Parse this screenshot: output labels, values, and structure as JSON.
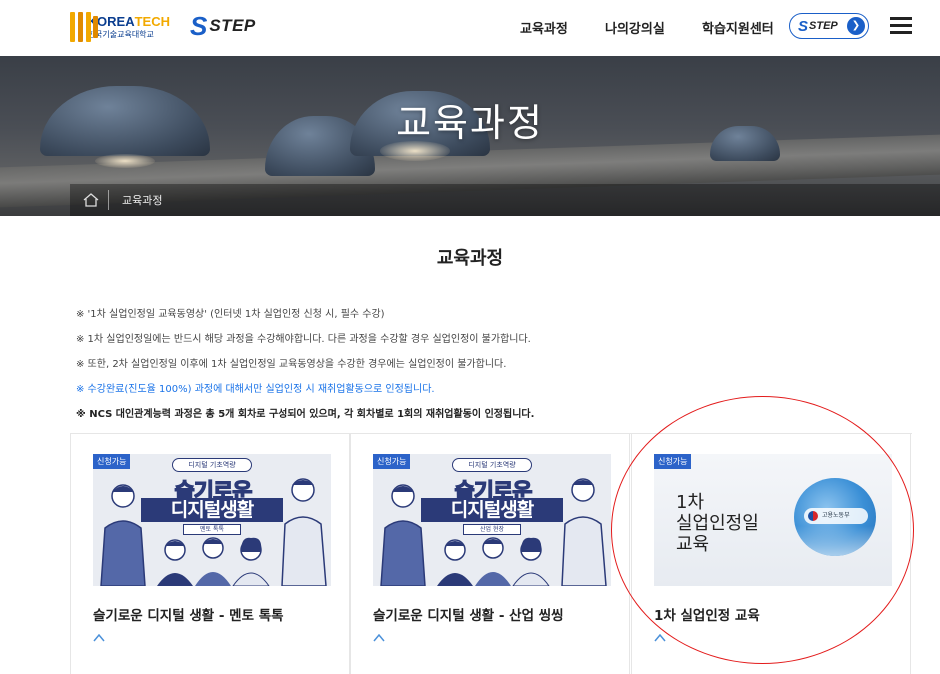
{
  "header": {
    "logo_en_a": "KOREA",
    "logo_en_b": "TECH",
    "logo_ko": "한국기술교육대학교",
    "step_logo_s": "S",
    "step_logo_text": "STEP",
    "nav": [
      "교육과정",
      "나의강의실",
      "학습지원센터"
    ],
    "step_badge_s": "S",
    "step_badge_text": "STEP",
    "step_badge_arrow": "❯"
  },
  "hero": {
    "title": "교육과정",
    "breadcrumb": "교육과정"
  },
  "main": {
    "section_title": "교육과정",
    "notices": [
      "※ '1차 실업인정일 교육동영상' (인터넷 1차 실업인정 신청 시, 필수 수강)",
      "※ 1차 실업인정일에는 반드시 해당 과정을 수강해야합니다. 다른 과정을 수강할 경우 실업인정이 불가합니다.",
      "※ 또한, 2차 실업인정일 이후에 1차 실업인정일 교육동영상을 수강한 경우에는 실업인정이 불가합니다.",
      "※ 수강완료(진도율 100%) 과정에 대해서만 실업인정 시 재취업활동으로 인정됩니다.",
      "※ NCS 대인관계능력 과정은 총 5개 회차로 구성되어 있으며, 각 회차별로 1회의 재취업활동이 인정됩니다."
    ],
    "cards": [
      {
        "badge": "신청가능",
        "thumb_ribbon": "디지털 기초역량",
        "thumb_big1": "슬기로운",
        "thumb_big2": "디지털생활",
        "thumb_sub": "멘토 톡톡",
        "title": "슬기로운 디지털 생활 - 멘토 톡톡"
      },
      {
        "badge": "신청가능",
        "thumb_ribbon": "디지털 기초역량",
        "thumb_big1": "슬기로운",
        "thumb_big2": "디지털생활",
        "thumb_sub": "산업 현장",
        "title": "슬기로운 디지털 생활 - 산업 씽씽"
      },
      {
        "badge": "신청가능",
        "thumb_line1": "1차",
        "thumb_line2": "실업인정일",
        "thumb_line3": "교육",
        "thumb_logo": "고용노동부",
        "title": "1차 실업인정 교육"
      }
    ]
  },
  "colors": {
    "brand_blue": "#1a5fc8",
    "badge_blue": "#2c63c9",
    "notice_blue": "#1a73e8",
    "annotation_red": "#e31b1b"
  },
  "icons": [
    "home-icon",
    "hamburger-menu-icon",
    "arrow-right-icon"
  ]
}
